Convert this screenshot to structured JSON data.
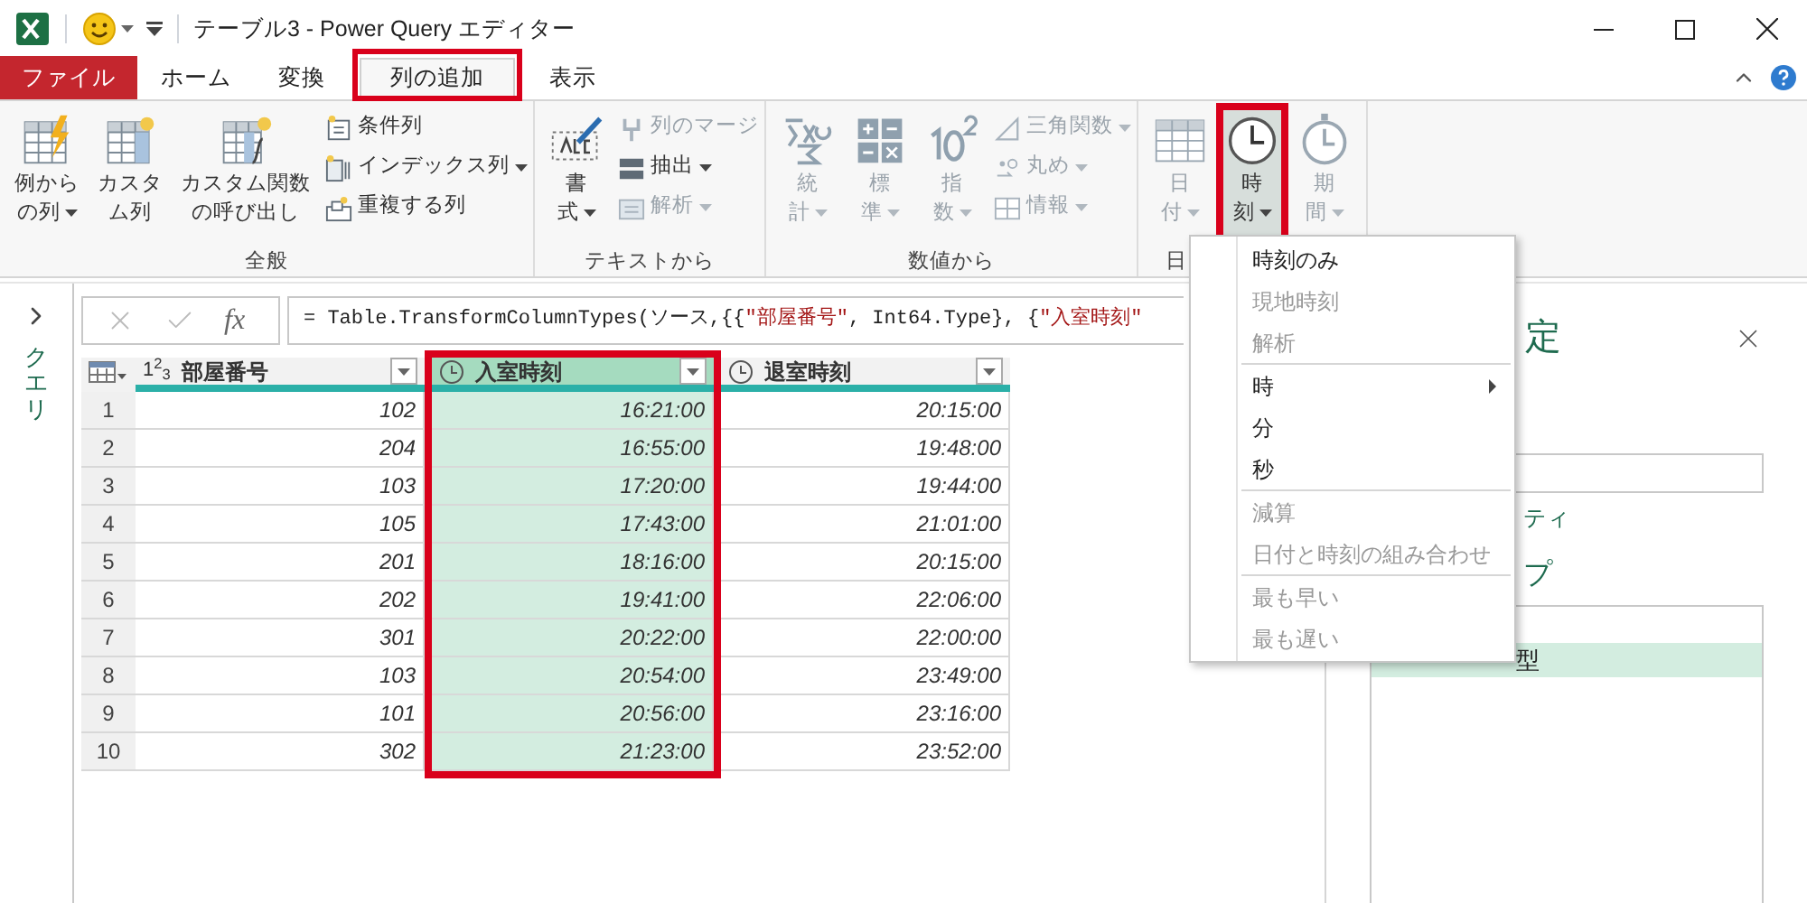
{
  "window": {
    "title": "テーブル3 - Power Query エディター"
  },
  "tabs": [
    {
      "label": "ファイル",
      "kind": "file",
      "selected": false,
      "highlighted": false
    },
    {
      "label": "ホーム",
      "kind": "tab",
      "selected": false,
      "highlighted": false
    },
    {
      "label": "変換",
      "kind": "tab",
      "selected": false,
      "highlighted": false
    },
    {
      "label": "列の追加",
      "kind": "tab",
      "selected": true,
      "highlighted": true
    },
    {
      "label": "表示",
      "kind": "tab",
      "selected": false,
      "highlighted": false
    }
  ],
  "ribbon": [
    {
      "label": "全般",
      "large": [
        {
          "lines": [
            "例から",
            "の列"
          ],
          "dropdown": true,
          "disabled": false,
          "pressed": false,
          "highlighted": false
        },
        {
          "lines": [
            "カスタ",
            "ム列"
          ],
          "dropdown": false,
          "disabled": false,
          "pressed": false,
          "highlighted": false
        },
        {
          "lines": [
            "カスタム関数",
            "の呼び出し"
          ],
          "dropdown": false,
          "disabled": false,
          "pressed": false,
          "highlighted": false
        }
      ],
      "small": [
        {
          "label": "条件列",
          "dropdown": false,
          "disabled": false
        },
        {
          "label": "インデックス列",
          "dropdown": true,
          "disabled": false
        },
        {
          "label": "重複する列",
          "dropdown": false,
          "disabled": false
        }
      ]
    },
    {
      "label": "テキストから",
      "large": [
        {
          "lines": [
            "書",
            "式"
          ],
          "dropdown": true,
          "disabled": false,
          "pressed": false,
          "highlighted": false
        }
      ],
      "small": [
        {
          "label": "列のマージ",
          "dropdown": false,
          "disabled": true
        },
        {
          "label": "抽出",
          "dropdown": true,
          "disabled": false
        },
        {
          "label": "解析",
          "dropdown": true,
          "disabled": true
        }
      ]
    },
    {
      "label": "数値から",
      "large": [
        {
          "lines": [
            "統",
            "計"
          ],
          "dropdown": true,
          "disabled": true,
          "pressed": false,
          "highlighted": false
        },
        {
          "lines": [
            "標",
            "準"
          ],
          "dropdown": true,
          "disabled": true,
          "pressed": false,
          "highlighted": false
        },
        {
          "lines": [
            "指",
            "数"
          ],
          "dropdown": true,
          "disabled": true,
          "pressed": false,
          "highlighted": false
        }
      ],
      "small": [
        {
          "label": "三角関数",
          "dropdown": true,
          "disabled": true
        },
        {
          "label": "丸め",
          "dropdown": true,
          "disabled": true
        },
        {
          "label": "情報",
          "dropdown": true,
          "disabled": true
        }
      ]
    },
    {
      "label": "日",
      "large": [
        {
          "lines": [
            "日",
            "付"
          ],
          "dropdown": true,
          "disabled": true,
          "pressed": false,
          "highlighted": false
        },
        {
          "lines": [
            "時",
            "刻"
          ],
          "dropdown": true,
          "disabled": false,
          "pressed": true,
          "highlighted": true
        },
        {
          "lines": [
            "期",
            "間"
          ],
          "dropdown": true,
          "disabled": true,
          "pressed": false,
          "highlighted": false
        }
      ]
    }
  ],
  "queries_pane": {
    "label": "クエリ"
  },
  "formula": {
    "fx": "fx",
    "parts": [
      {
        "text": "= Table.TransformColumnTypes(ソース,{{",
        "kind": "code"
      },
      {
        "text": "\"部屋番号\"",
        "kind": "string"
      },
      {
        "text": ", Int64.Type}, {",
        "kind": "code"
      },
      {
        "text": "\"入室時刻\"",
        "kind": "string"
      }
    ]
  },
  "table": {
    "columns": [
      {
        "name": "部屋番号",
        "kind": "number",
        "type_glyph": "1$^{2}$$_{3}$",
        "selected": false,
        "highlighted": false
      },
      {
        "name": "入室時刻",
        "kind": "time",
        "selected": true,
        "highlighted": true
      },
      {
        "name": "退室時刻",
        "kind": "time",
        "selected": false,
        "highlighted": false
      }
    ],
    "rows": [
      {
        "n": "1",
        "cells": [
          "102",
          "16:21:00",
          "20:15:00"
        ]
      },
      {
        "n": "2",
        "cells": [
          "204",
          "16:55:00",
          "19:48:00"
        ]
      },
      {
        "n": "3",
        "cells": [
          "103",
          "17:20:00",
          "19:44:00"
        ]
      },
      {
        "n": "4",
        "cells": [
          "105",
          "17:43:00",
          "21:01:00"
        ]
      },
      {
        "n": "5",
        "cells": [
          "201",
          "18:16:00",
          "20:15:00"
        ]
      },
      {
        "n": "6",
        "cells": [
          "202",
          "19:41:00",
          "22:06:00"
        ]
      },
      {
        "n": "7",
        "cells": [
          "301",
          "20:22:00",
          "22:00:00"
        ]
      },
      {
        "n": "8",
        "cells": [
          "103",
          "20:54:00",
          "23:49:00"
        ]
      },
      {
        "n": "9",
        "cells": [
          "101",
          "20:56:00",
          "23:16:00"
        ]
      },
      {
        "n": "10",
        "cells": [
          "302",
          "21:23:00",
          "23:52:00"
        ]
      }
    ]
  },
  "settings": {
    "title": "定",
    "properties_label": "ティ",
    "steps_label": "プ",
    "steps": [
      {
        "label": "型",
        "selected": true
      }
    ]
  },
  "menu": {
    "groups": [
      [
        {
          "label": "時刻のみ",
          "disabled": false,
          "submenu": false
        },
        {
          "label": "現地時刻",
          "disabled": true,
          "submenu": false
        },
        {
          "label": "解析",
          "disabled": true,
          "submenu": false
        }
      ],
      [
        {
          "label": "時",
          "disabled": false,
          "submenu": true
        },
        {
          "label": "分",
          "disabled": false,
          "submenu": false
        },
        {
          "label": "秒",
          "disabled": false,
          "submenu": false
        }
      ],
      [
        {
          "label": "減算",
          "disabled": true,
          "submenu": false
        },
        {
          "label": "日付と時刻の組み合わせ",
          "disabled": true,
          "submenu": false
        }
      ],
      [
        {
          "label": "最も早い",
          "disabled": true,
          "submenu": false
        },
        {
          "label": "最も遅い",
          "disabled": true,
          "submenu": false
        }
      ]
    ]
  }
}
